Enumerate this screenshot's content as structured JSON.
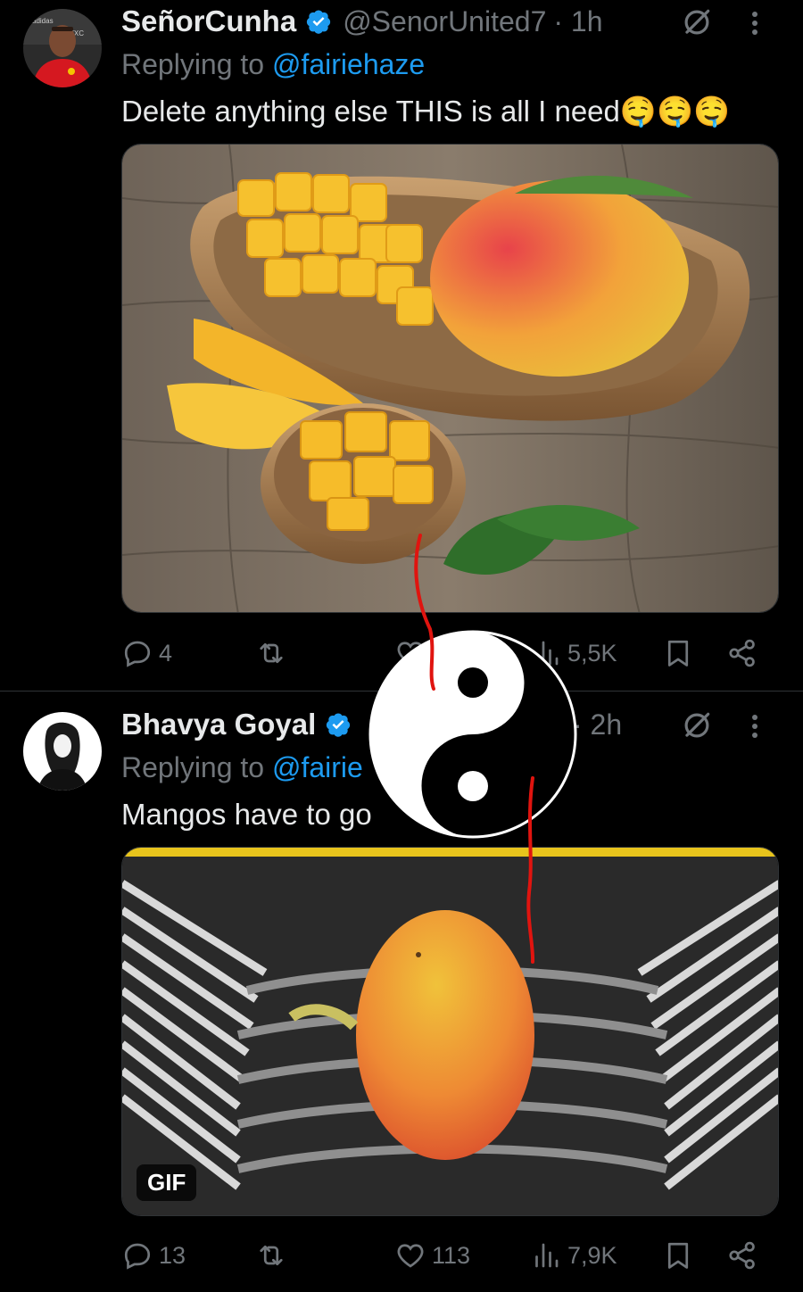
{
  "tweets": [
    {
      "author_name": "SeñorCunha",
      "handle": "@SenorUnited7",
      "time": "· 1h",
      "replying_prefix": "Replying to ",
      "replying_to": "@fairiehaze",
      "text": "Delete anything else THIS is all I need🤤🤤🤤",
      "media_type": "image",
      "replies": "4",
      "retweets": "",
      "likes": "",
      "views": "5,5K"
    },
    {
      "author_name": "Bhavya Goyal",
      "handle": "",
      "time": "· 2h",
      "replying_prefix": "Replying to ",
      "replying_to": "@fairie",
      "text": "Mangos have to go",
      "media_type": "gif",
      "media_badge": "GIF",
      "replies": "13",
      "retweets": "",
      "likes": "113",
      "views": "7,9K"
    }
  ],
  "icons": {
    "verified": "verified-badge-icon",
    "grok": "grok-icon",
    "more": "more-icon",
    "reply": "reply-icon",
    "retweet": "retweet-icon",
    "like": "heart-icon",
    "views": "views-icon",
    "bookmark": "bookmark-icon",
    "share": "share-icon"
  },
  "colors": {
    "background": "#000000",
    "text_primary": "#e7e9ea",
    "text_secondary": "#71767b",
    "accent": "#1d9bf0",
    "divider": "#2f3336",
    "overlay_line": "#e0140f"
  }
}
